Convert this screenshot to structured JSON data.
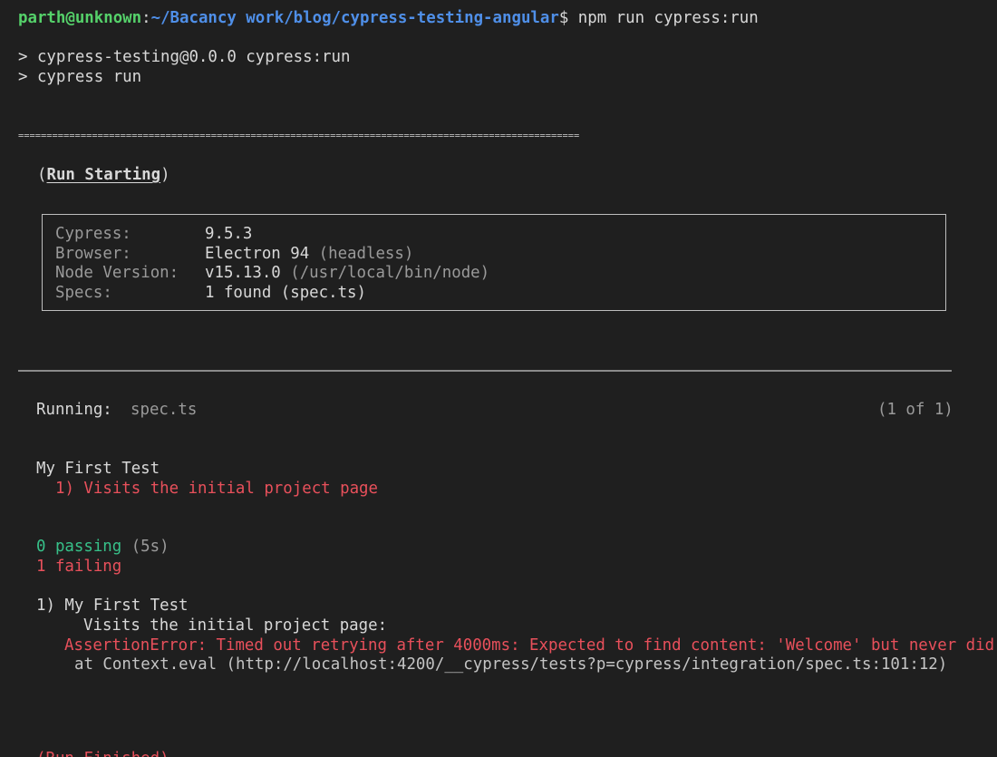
{
  "prompt": {
    "user_host": "parth@unknown",
    "separator": ":",
    "path": "~/Bacancy work/blog/cypress-testing-angular",
    "symbol": "$",
    "command": " npm run cypress:run"
  },
  "npm_output": [
    "> cypress-testing@0.0.0 cypress:run",
    "> cypress run"
  ],
  "double_rule": "===================================================================================================",
  "run_starting": {
    "open_paren": "(",
    "label": "Run Starting",
    "close_paren": ")"
  },
  "info_box": {
    "rows": [
      {
        "key": "Cypress:",
        "value": "9.5.3",
        "extra": ""
      },
      {
        "key": "Browser:",
        "value": "Electron 94",
        "extra": " (headless)"
      },
      {
        "key": "Node Version:",
        "value": "v15.13.0",
        "extra": " (/usr/local/bin/node)"
      },
      {
        "key": "Specs:",
        "value": "1 found (spec.ts)",
        "extra": ""
      }
    ]
  },
  "running": {
    "label": "Running:",
    "spec": "spec.ts",
    "count": "(1 of 1)"
  },
  "suite": {
    "title": "My First Test",
    "failed_test": "1) Visits the initial project page"
  },
  "summary": {
    "passing": "0 passing",
    "passing_time": " (5s)",
    "failing": "1 failing"
  },
  "failure": {
    "heading": "1) My First Test",
    "test": "Visits the initial project page:",
    "error": "AssertionError: Timed out retrying after 4000ms: Expected to find content: 'Welcome' but never did.",
    "stack": "at Context.eval (http://localhost:4200/__cypress/tests?p=cypress/integration/spec.ts:101:12)"
  },
  "cut_off_line": "(Run Finished)"
}
